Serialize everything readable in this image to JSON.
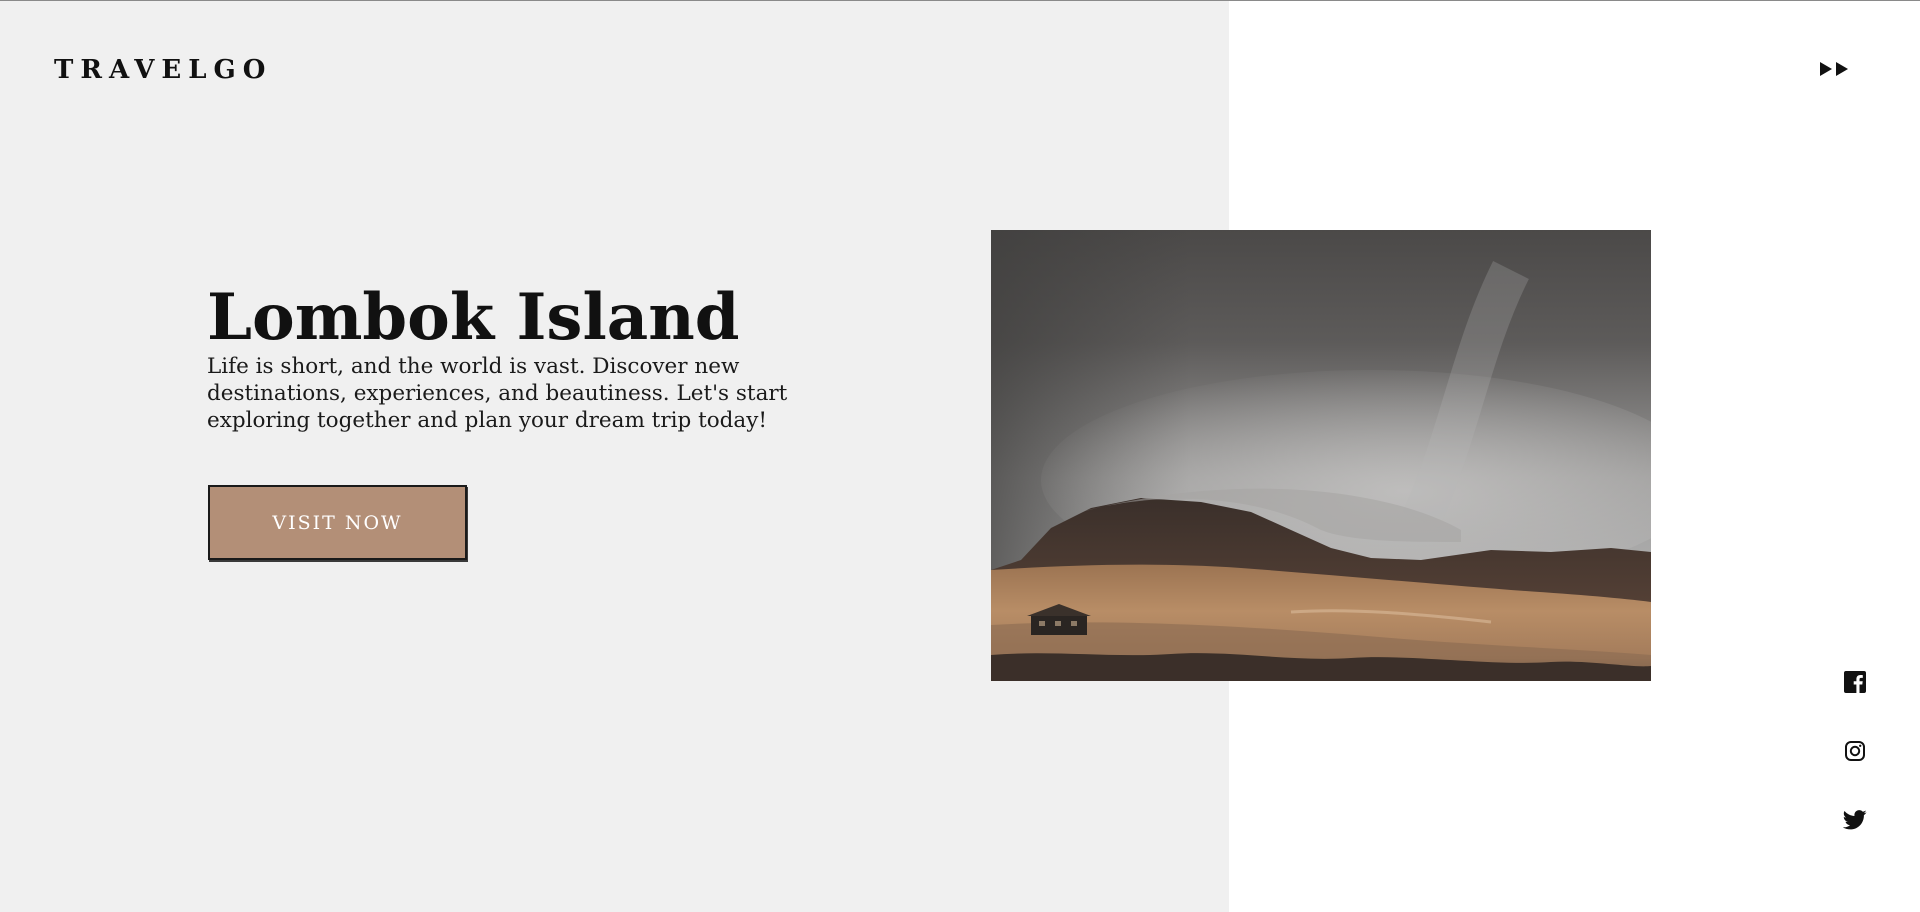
{
  "header": {
    "brand": "TRAVELGO",
    "menu_icon": "fast-forward-icon"
  },
  "hero": {
    "title": "Lombok Island",
    "description": "Life is short, and the world is vast. Discover new destinations, experiences, and beautiness. Let's start exploring together and plan your dream trip today!",
    "cta_label": "VISIT NOW",
    "cta_color": "#b38f77"
  },
  "social": {
    "items": [
      {
        "icon": "facebook-icon"
      },
      {
        "icon": "instagram-icon"
      },
      {
        "icon": "twitter-icon"
      }
    ]
  },
  "colors": {
    "left_panel": "#f0f0f0",
    "background": "#ffffff",
    "text": "#111111"
  }
}
